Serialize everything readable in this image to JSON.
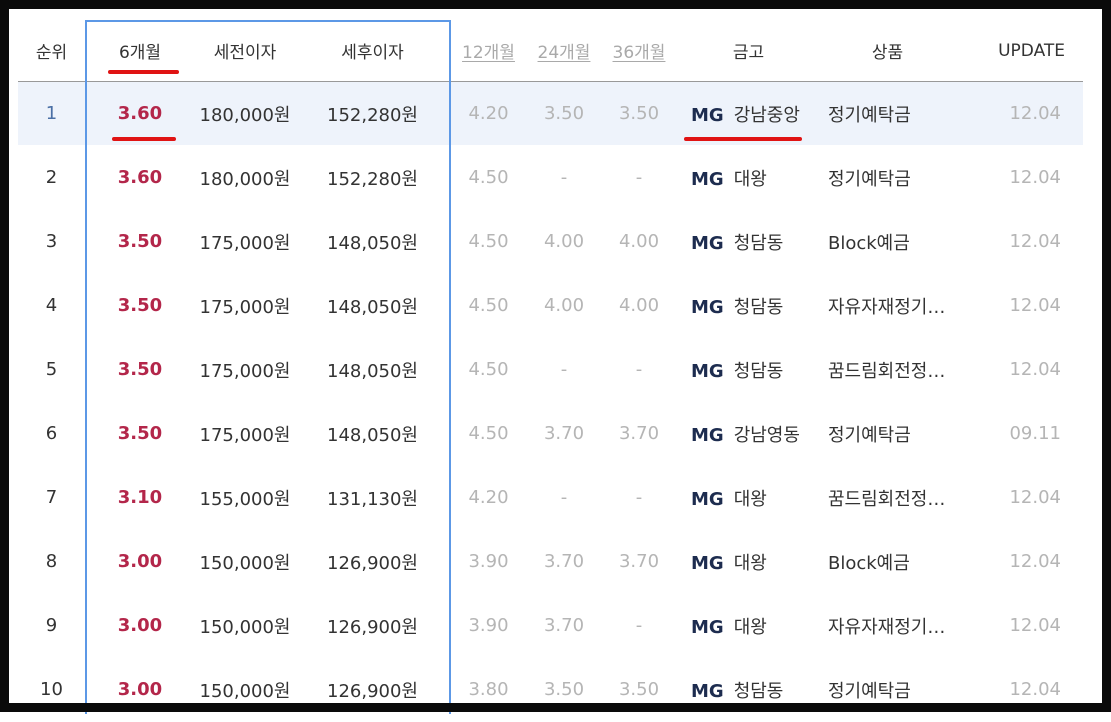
{
  "headers": {
    "rank": "순위",
    "m6": "6개월",
    "pretax": "세전이자",
    "posttax": "세후이자",
    "m12": "12개월",
    "m24": "24개월",
    "m36": "36개월",
    "bank": "금고",
    "product": "상품",
    "update": "UPDATE"
  },
  "rows": [
    {
      "rank": "1",
      "m6": "3.60",
      "pretax": "180,000원",
      "posttax": "152,280원",
      "m12": "4.20",
      "m24": "3.50",
      "m36": "3.50",
      "mg": "MG",
      "bank": "강남중앙",
      "product": "정기예탁금",
      "update": "12.04"
    },
    {
      "rank": "2",
      "m6": "3.60",
      "pretax": "180,000원",
      "posttax": "152,280원",
      "m12": "4.50",
      "m24": "-",
      "m36": "-",
      "mg": "MG",
      "bank": "대왕",
      "product": "정기예탁금",
      "update": "12.04"
    },
    {
      "rank": "3",
      "m6": "3.50",
      "pretax": "175,000원",
      "posttax": "148,050원",
      "m12": "4.50",
      "m24": "4.00",
      "m36": "4.00",
      "mg": "MG",
      "bank": "청담동",
      "product": "Block예금",
      "update": "12.04"
    },
    {
      "rank": "4",
      "m6": "3.50",
      "pretax": "175,000원",
      "posttax": "148,050원",
      "m12": "4.50",
      "m24": "4.00",
      "m36": "4.00",
      "mg": "MG",
      "bank": "청담동",
      "product": "자유자재정기예…",
      "update": "12.04"
    },
    {
      "rank": "5",
      "m6": "3.50",
      "pretax": "175,000원",
      "posttax": "148,050원",
      "m12": "4.50",
      "m24": "-",
      "m36": "-",
      "mg": "MG",
      "bank": "청담동",
      "product": "꿈드림회전정기…",
      "update": "12.04"
    },
    {
      "rank": "6",
      "m6": "3.50",
      "pretax": "175,000원",
      "posttax": "148,050원",
      "m12": "4.50",
      "m24": "3.70",
      "m36": "3.70",
      "mg": "MG",
      "bank": "강남영동",
      "product": "정기예탁금",
      "update": "09.11"
    },
    {
      "rank": "7",
      "m6": "3.10",
      "pretax": "155,000원",
      "posttax": "131,130원",
      "m12": "4.20",
      "m24": "-",
      "m36": "-",
      "mg": "MG",
      "bank": "대왕",
      "product": "꿈드림회전정기…",
      "update": "12.04"
    },
    {
      "rank": "8",
      "m6": "3.00",
      "pretax": "150,000원",
      "posttax": "126,900원",
      "m12": "3.90",
      "m24": "3.70",
      "m36": "3.70",
      "mg": "MG",
      "bank": "대왕",
      "product": "Block예금",
      "update": "12.04"
    },
    {
      "rank": "9",
      "m6": "3.00",
      "pretax": "150,000원",
      "posttax": "126,900원",
      "m12": "3.90",
      "m24": "3.70",
      "m36": "-",
      "mg": "MG",
      "bank": "대왕",
      "product": "자유자재정기예…",
      "update": "12.04"
    },
    {
      "rank": "10",
      "m6": "3.00",
      "pretax": "150,000원",
      "posttax": "126,900원",
      "m12": "3.80",
      "m24": "3.50",
      "m36": "3.50",
      "mg": "MG",
      "bank": "청담동",
      "product": "정기예탁금",
      "update": "12.04"
    }
  ],
  "colors": {
    "highlight_box": "#5c98e6",
    "annotation": "#e01313",
    "rate": "#b3264a",
    "selected_row": "#eef3fb"
  }
}
